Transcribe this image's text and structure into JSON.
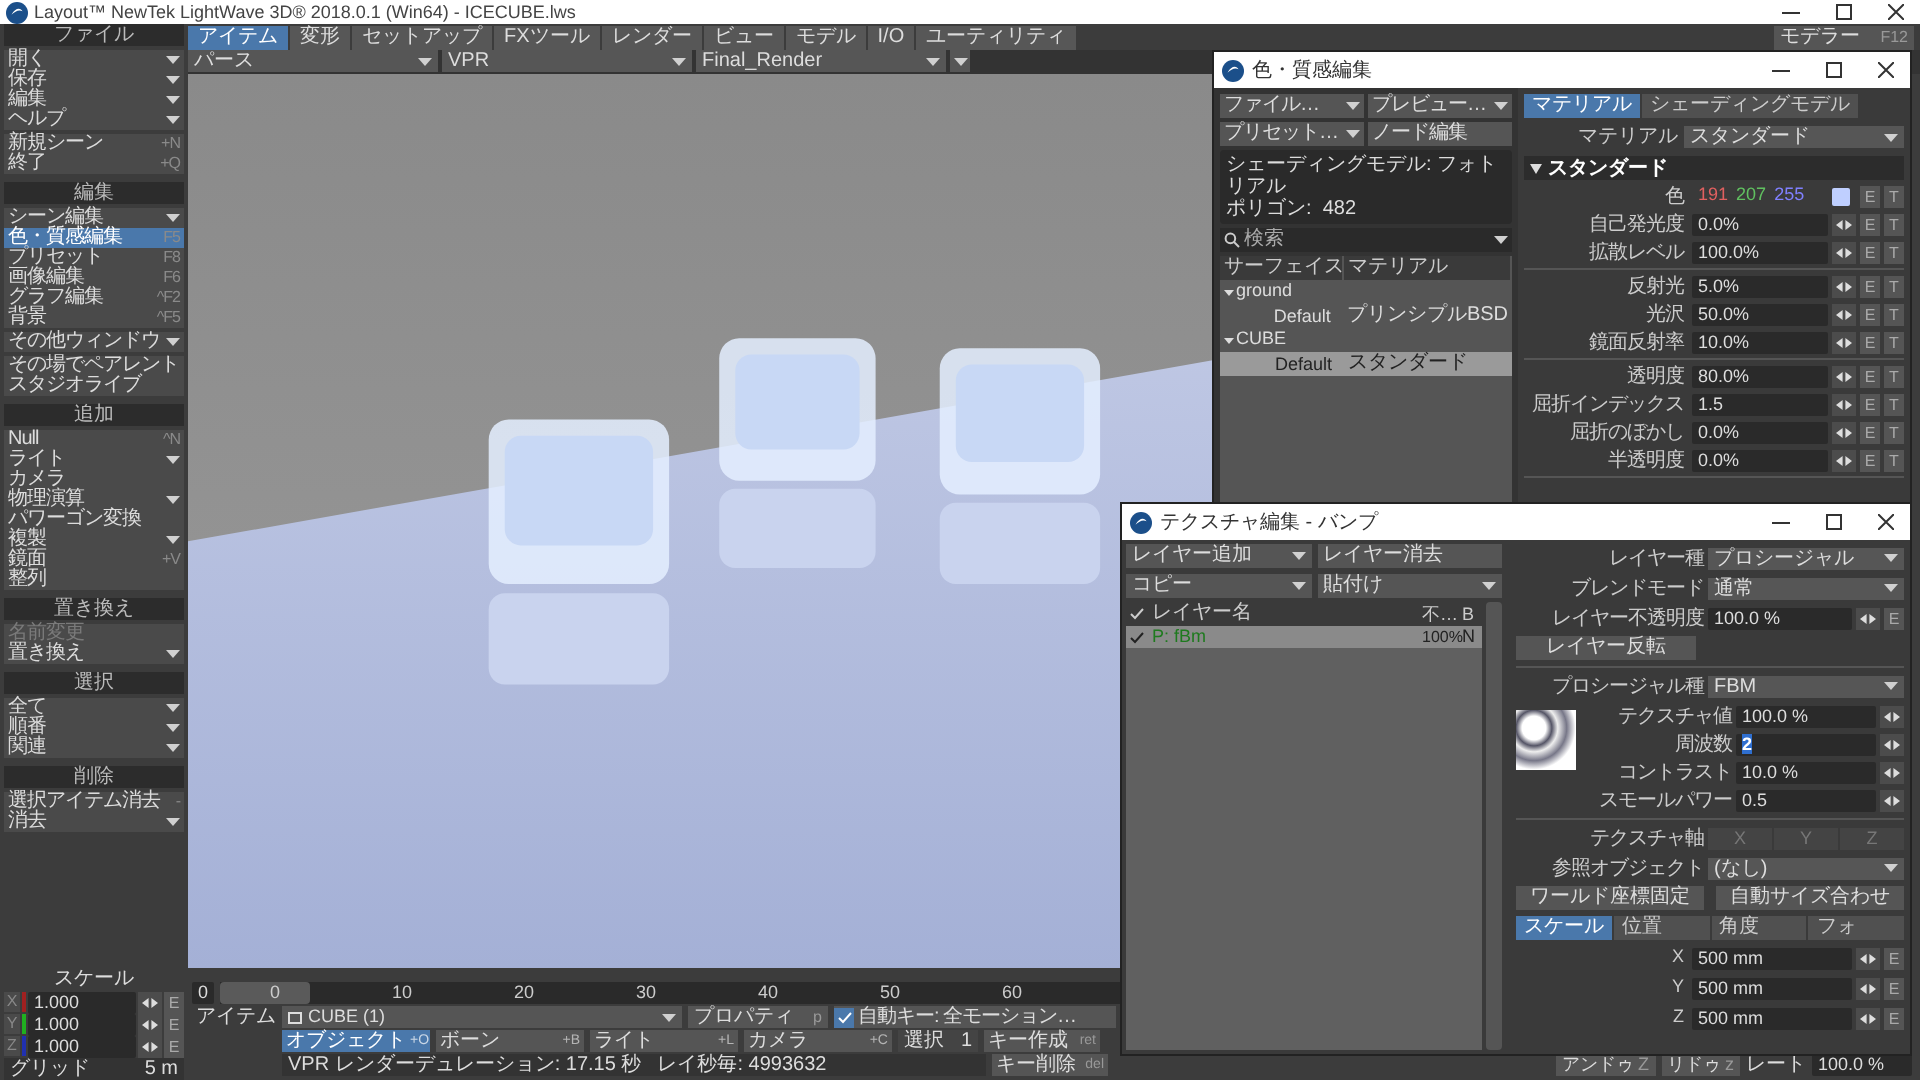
{
  "window": {
    "title": "Layout™ NewTek LightWave 3D® 2018.0.1 (Win64) - ICECUBE.lws"
  },
  "sidebar": {
    "sections": [
      {
        "title": "ファイル",
        "groups": [
          {
            "items": [
              {
                "label": "開く",
                "kind": "menu",
                "active": false,
                "disabled": false
              },
              {
                "label": "保存",
                "kind": "menu",
                "active": false,
                "disabled": false
              },
              {
                "label": "編集",
                "kind": "menu",
                "active": false,
                "disabled": false
              },
              {
                "label": "ヘルプ",
                "kind": "menu",
                "active": false,
                "disabled": false
              }
            ]
          },
          {
            "items": [
              {
                "label": "新規シーン",
                "kind": "action",
                "shortcut": "+N",
                "active": false,
                "disabled": false
              },
              {
                "label": "終了",
                "kind": "action",
                "shortcut": "+Q",
                "active": false,
                "disabled": false
              }
            ]
          }
        ]
      },
      {
        "title": "編集",
        "groups": [
          {
            "items": [
              {
                "label": "シーン編集",
                "kind": "menu",
                "active": false,
                "disabled": false
              },
              {
                "label": "色・質感編集",
                "kind": "action",
                "shortcut": "F5",
                "active": true,
                "disabled": false
              },
              {
                "label": "プリセット",
                "kind": "action",
                "shortcut": "F8",
                "active": false,
                "disabled": false
              },
              {
                "label": "画像編集",
                "kind": "action",
                "shortcut": "F6",
                "active": false,
                "disabled": false
              },
              {
                "label": "グラフ編集",
                "kind": "action",
                "shortcut": "^F2",
                "active": false,
                "disabled": false
              },
              {
                "label": "背景",
                "kind": "action",
                "shortcut": "^F5",
                "active": false,
                "disabled": false
              }
            ]
          },
          {
            "items": [
              {
                "label": "その他ウィンドウ",
                "kind": "menu",
                "active": false,
                "disabled": false
              }
            ]
          },
          {
            "items": [
              {
                "label": "その場でペアレント",
                "kind": "action",
                "active": false,
                "disabled": false
              },
              {
                "label": "スタジオライブ",
                "kind": "action",
                "active": false,
                "disabled": false
              }
            ]
          }
        ]
      },
      {
        "title": "追加",
        "groups": [
          {
            "items": [
              {
                "label": "Null",
                "kind": "action",
                "shortcut": "^N",
                "active": false,
                "disabled": false
              },
              {
                "label": "ライト",
                "kind": "menu",
                "active": false,
                "disabled": false
              },
              {
                "label": "カメラ",
                "kind": "action",
                "active": false,
                "disabled": false
              },
              {
                "label": "物理演算",
                "kind": "menu",
                "active": false,
                "disabled": false
              },
              {
                "label": "パワーゴン変換",
                "kind": "action",
                "active": false,
                "disabled": false
              },
              {
                "label": "複製",
                "kind": "menu",
                "active": false,
                "disabled": false
              },
              {
                "label": "鏡面",
                "kind": "action",
                "shortcut": "+V",
                "active": false,
                "disabled": false
              },
              {
                "label": "整列",
                "kind": "action",
                "active": false,
                "disabled": false
              }
            ]
          }
        ]
      },
      {
        "title": "置き換え",
        "groups": [
          {
            "items": [
              {
                "label": "名前変更",
                "kind": "action",
                "active": false,
                "disabled": true
              },
              {
                "label": "置き換え",
                "kind": "menu",
                "active": false,
                "disabled": false
              }
            ]
          }
        ]
      },
      {
        "title": "選択",
        "groups": [
          {
            "items": [
              {
                "label": "全て",
                "kind": "menu",
                "active": false,
                "disabled": false
              },
              {
                "label": "順番",
                "kind": "menu",
                "active": false,
                "disabled": false
              },
              {
                "label": "関連",
                "kind": "menu",
                "active": false,
                "disabled": false
              }
            ]
          }
        ]
      },
      {
        "title": "削除",
        "groups": [
          {
            "items": [
              {
                "label": "選択アイテム消去",
                "kind": "action",
                "shortcut": "-",
                "active": false,
                "disabled": false
              },
              {
                "label": "消去",
                "kind": "menu",
                "active": false,
                "disabled": false
              }
            ]
          }
        ]
      }
    ]
  },
  "tabs": [
    {
      "label": "アイテム",
      "selected": true
    },
    {
      "label": "変形",
      "selected": false
    },
    {
      "label": "セットアップ",
      "selected": false
    },
    {
      "label": "FXツール",
      "selected": false
    },
    {
      "label": "レンダー",
      "selected": false
    },
    {
      "label": "ビュー",
      "selected": false
    },
    {
      "label": "モデル",
      "selected": false
    },
    {
      "label": "I/O",
      "selected": false
    },
    {
      "label": "ユーティリティ",
      "selected": false
    }
  ],
  "modeler_button": {
    "label": "モデラー",
    "shortcut": "F12"
  },
  "viewport": {
    "dropdowns": [
      "パース",
      "VPR",
      "Final_Render"
    ]
  },
  "bottom": {
    "scale_label": "スケール",
    "axes": [
      {
        "axis": "X",
        "value": "1.000",
        "button": "E",
        "color": "#a02020"
      },
      {
        "axis": "Y",
        "value": "1.000",
        "button": "E",
        "color": "#20b020"
      },
      {
        "axis": "Z",
        "value": "1.000",
        "button": "E",
        "color": "#2030b0"
      }
    ],
    "grid": {
      "label": "グリッド",
      "value": "5 m"
    },
    "timeline": {
      "frame": "0",
      "ticks": [
        "0",
        "10",
        "20",
        "30",
        "40",
        "50",
        "60"
      ],
      "level": 0
    },
    "item": {
      "label": "アイテム",
      "value": "CUBE (1)"
    },
    "properties_button": {
      "label": "プロパティ",
      "shortcut": "p"
    },
    "auto_key": {
      "label": "自動キー: 全モーション…",
      "checked": true
    },
    "item_types": [
      {
        "label": "オブジェクト",
        "shortcut": "+O",
        "selected": true
      },
      {
        "label": "ボーン",
        "shortcut": "+B",
        "selected": false
      },
      {
        "label": "ライト",
        "shortcut": "+L",
        "selected": false
      },
      {
        "label": "カメラ",
        "shortcut": "+C",
        "selected": false
      }
    ],
    "selection": {
      "label": "選択",
      "value": "1"
    },
    "create_key": {
      "label": "キー作成",
      "shortcut": "ret"
    },
    "delete_key": {
      "label": "キー削除",
      "shortcut": "del"
    },
    "status": [
      "VPR レンダーデュレーション: 17.15 秒",
      "レイ秒毎: 4993632"
    ],
    "undo": {
      "label": "アンドゥ",
      "shortcut": "Z"
    },
    "redo": {
      "label": "リドゥ",
      "shortcut": "z"
    },
    "rate": {
      "label": "レート",
      "value": "100.0 %"
    }
  },
  "surface_editor": {
    "title": "色・質感編集",
    "buttons": [
      {
        "label": "ファイル…",
        "kind": "menu"
      },
      {
        "label": "プレビュー…",
        "kind": "menu"
      },
      {
        "label": "プリセット…",
        "kind": "menu"
      },
      {
        "label": "ノード編集",
        "kind": "action"
      }
    ],
    "info": [
      "シェーディングモデル: フォトリアル",
      "ポリゴン:  482"
    ],
    "search": {
      "placeholder": "検索"
    },
    "columns": [
      "サーフェイス",
      "マテリアル"
    ],
    "tree": [
      {
        "name": "ground",
        "expanded": true,
        "selected": false,
        "children": [
          {
            "name": "Default",
            "material": "プリンシプルBSD",
            "selected": false
          }
        ]
      },
      {
        "name": "CUBE",
        "expanded": true,
        "selected": false,
        "children": [
          {
            "name": "Default",
            "material": "スタンダード",
            "selected": true
          }
        ]
      }
    ],
    "tabs": [
      {
        "label": "マテリアル",
        "selected": true
      },
      {
        "label": "シェーディングモデル",
        "selected": false
      }
    ],
    "material": {
      "label": "マテリアル",
      "value": "スタンダード"
    },
    "section": {
      "title": "スタンダード",
      "expanded": true
    },
    "property_groups": [
      {
        "items": [
          {
            "kind": "color",
            "label": "色",
            "values": [
              "191",
              "207",
              "255"
            ],
            "color": "#bfcfff",
            "buttons": [
              "E",
              "T"
            ]
          },
          {
            "kind": "number",
            "label": "自己発光度",
            "value": "0.0%",
            "buttons": [
              "E",
              "T"
            ]
          },
          {
            "kind": "number",
            "label": "拡散レベル",
            "value": "100.0%",
            "buttons": [
              "E",
              "T"
            ]
          }
        ]
      },
      {
        "items": [
          {
            "kind": "number",
            "label": "反射光",
            "value": "5.0%",
            "buttons": [
              "E",
              "T"
            ]
          },
          {
            "kind": "number",
            "label": "光沢",
            "value": "50.0%",
            "buttons": [
              "E",
              "T"
            ]
          },
          {
            "kind": "number",
            "label": "鏡面反射率",
            "value": "10.0%",
            "buttons": [
              "E",
              "T"
            ]
          }
        ]
      },
      {
        "items": [
          {
            "kind": "number",
            "label": "透明度",
            "value": "80.0%",
            "buttons": [
              "E",
              "T"
            ]
          },
          {
            "kind": "number",
            "label": "屈折インデックス",
            "value": "1.5",
            "buttons": [
              "E",
              "T"
            ]
          },
          {
            "kind": "number",
            "label": "屈折のぼかし",
            "value": "0.0%",
            "buttons": [
              "E",
              "T"
            ]
          },
          {
            "kind": "number",
            "label": "半透明度",
            "value": "0.0%",
            "buttons": [
              "E",
              "T"
            ]
          }
        ]
      }
    ]
  },
  "texture_editor": {
    "title": "テクスチャ編集 - バンプ",
    "buttons": [
      {
        "label": "レイヤー追加",
        "kind": "menu"
      },
      {
        "label": "レイヤー消去",
        "kind": "action"
      },
      {
        "label": "コピー",
        "kind": "menu"
      },
      {
        "label": "貼付け",
        "kind": "menu"
      }
    ],
    "layer_columns": [
      "レイヤー名",
      "不…",
      "B"
    ],
    "layers": [
      {
        "enabled": true,
        "name": "P: fBm",
        "opacity": "100%",
        "blend": "N",
        "selected": true
      }
    ],
    "layer_settings": [
      {
        "kind": "dropdown",
        "label": "レイヤー種",
        "value": "プロシージャル"
      },
      {
        "kind": "dropdown",
        "label": "ブレンドモード",
        "value": "通常"
      },
      {
        "kind": "envelope",
        "label": "レイヤー不透明度",
        "value": "100.0 %",
        "button": "E"
      },
      {
        "kind": "button",
        "label": "レイヤー反転"
      }
    ],
    "procedural": {
      "label": "プロシージャル種",
      "value": "FBM",
      "params": [
        {
          "label": "テクスチャ値",
          "value": "100.0 %",
          "editing": false
        },
        {
          "label": "周波数",
          "value": "2",
          "editing": true
        },
        {
          "label": "コントラスト",
          "value": "10.0 %",
          "editing": false
        },
        {
          "label": "スモールパワー",
          "value": "0.5",
          "editing": false
        }
      ]
    },
    "mapping": {
      "axis": {
        "label": "テクスチャ軸",
        "options": [
          "X",
          "Y",
          "Z"
        ],
        "disabled": true
      },
      "reference": {
        "label": "参照オブジェクト",
        "value": "(なし)"
      },
      "buttons": [
        "ワールド座標固定",
        "自動サイズ合わせ"
      ],
      "tabs": [
        {
          "label": "スケール",
          "selected": true
        },
        {
          "label": "位置",
          "selected": false
        },
        {
          "label": "角度",
          "selected": false
        },
        {
          "label": "フォ",
          "selected": false
        }
      ],
      "values": [
        {
          "axis": "X",
          "value": "500 mm",
          "button": "E"
        },
        {
          "axis": "Y",
          "value": "500 mm",
          "button": "E"
        },
        {
          "axis": "Z",
          "value": "500 mm",
          "button": "E"
        }
      ]
    }
  }
}
